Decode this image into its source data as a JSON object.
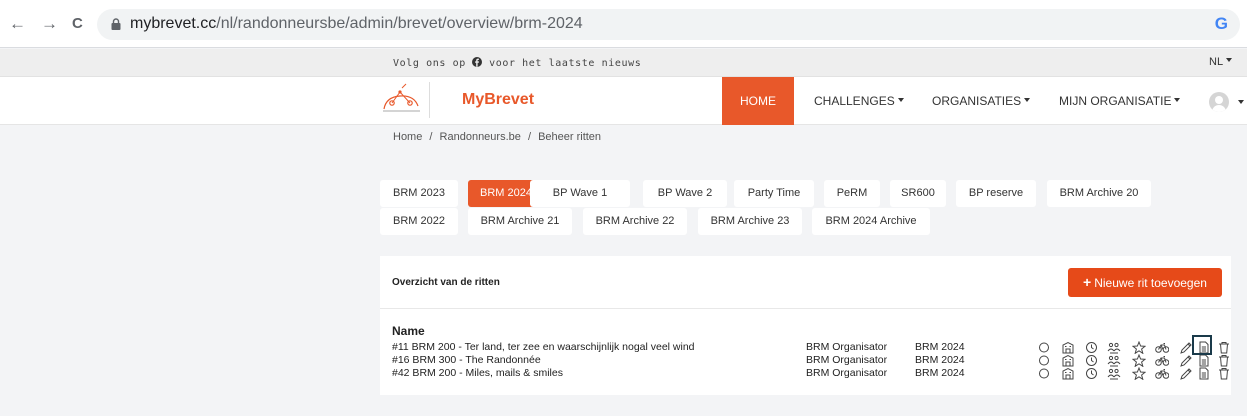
{
  "browser": {
    "back": "←",
    "forward": "→",
    "reload": "C",
    "url_host": "mybrevet.cc",
    "url_path": "/nl/randonneursbe/admin/brevet/overview/brm-2024",
    "profile": "G"
  },
  "topbar": {
    "follow_prefix": "Volg ons op",
    "follow_suffix": "voor het laatste nieuws",
    "language": "NL"
  },
  "header": {
    "brand": "MyBrevet",
    "menu": [
      {
        "label": "HOME"
      },
      {
        "label": "CHALLENGES"
      },
      {
        "label": "ORGANISATIES"
      },
      {
        "label": "MIJN ORGANISATIE"
      }
    ]
  },
  "breadcrumb": {
    "items": [
      "Home",
      "Randonneurs.be",
      "Beheer ritten"
    ],
    "separator": "/"
  },
  "tabs": [
    {
      "label": "BRM 2023"
    },
    {
      "label": "BRM 2024",
      "active": true
    },
    {
      "label": "BP Wave 1"
    },
    {
      "label": "BP Wave 2"
    },
    {
      "label": "Party Time"
    },
    {
      "label": "PeRM"
    },
    {
      "label": "SR600"
    },
    {
      "label": "BP reserve"
    },
    {
      "label": "BRM Archive 20"
    },
    {
      "label": "BRM 2022"
    },
    {
      "label": "BRM Archive 21"
    },
    {
      "label": "BRM Archive 22"
    },
    {
      "label": "BRM Archive 23"
    },
    {
      "label": "BRM 2024 Archive"
    }
  ],
  "card": {
    "title": "Overzicht van de ritten",
    "new_button": "Nieuwe rit toevoegen",
    "column_name": "Name",
    "rows": [
      {
        "name": "#11 BRM 200 - Ter land, ter zee en waarschijnlijk nogal veel wind",
        "organizer": "BRM Organisator",
        "series": "BRM 2024"
      },
      {
        "name": "#16 BRM 300 - The Randonnée",
        "organizer": "BRM Organisator",
        "series": "BRM 2024"
      },
      {
        "name": "#42 BRM 200 - Miles, mails & smiles",
        "organizer": "BRM Organisator",
        "series": "BRM 2024"
      }
    ],
    "action_icons": [
      "circle-icon",
      "building-icon",
      "clock-icon",
      "group-icon",
      "star-icon",
      "bicycle-icon",
      "pencil-icon",
      "document-icon",
      "trash-icon"
    ]
  },
  "colors": {
    "accent": "#e8582a",
    "button": "#e64a19"
  }
}
